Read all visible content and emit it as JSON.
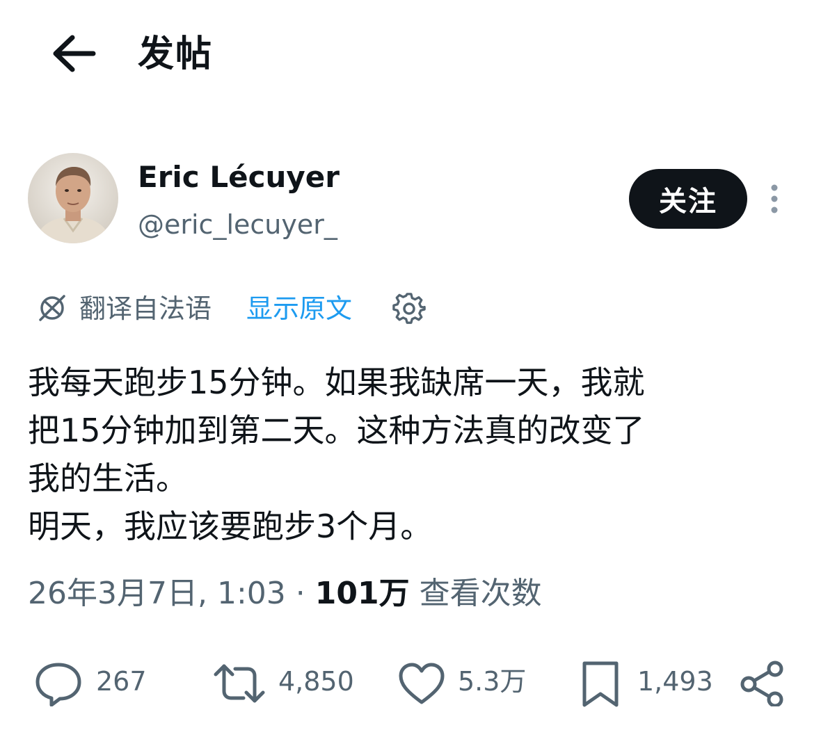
{
  "header": {
    "title": "发帖",
    "back_icon": "arrow-left-icon"
  },
  "author": {
    "name": "Eric Lécuyer",
    "handle": "@eric_lecuyer_",
    "follow_label": "关注"
  },
  "translation": {
    "label": "翻译自法语",
    "show_original_label": "显示原文",
    "icon": "translate-icon",
    "settings_icon": "gear-icon",
    "accent_color": "#1d9bf0"
  },
  "tweet": {
    "lines": [
      "我每天跑步15分钟。如果我缺席一天，我就",
      "把15分钟加到第二天。这种方法真的改变了",
      "我的生活。",
      "明天，我应该要跑步3个月。"
    ]
  },
  "meta": {
    "timestamp": "26年3月7日, 1:03",
    "separator": "·",
    "views_count": "101万",
    "views_label": "查看次数"
  },
  "actions": {
    "replies": "267",
    "reposts": "4,850",
    "likes": "5.3万",
    "bookmarks": "1,493"
  }
}
